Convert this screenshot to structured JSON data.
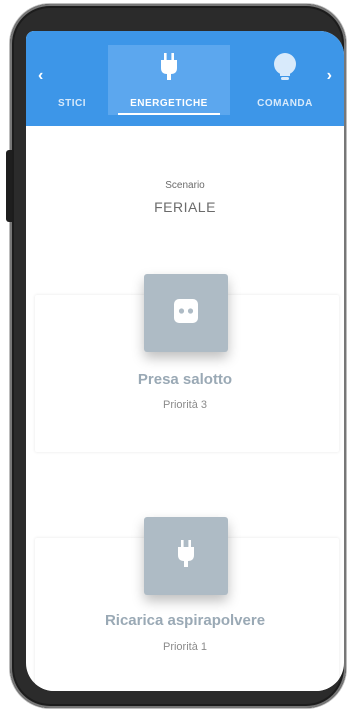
{
  "tabs": {
    "left_label": "STICI",
    "active_label": "ENERGETICHE",
    "right_label": "COMANDA"
  },
  "scenario": {
    "caption": "Scenario",
    "value": "FERIALE"
  },
  "devices": [
    {
      "name": "Presa salotto",
      "priority": "Priorità 3",
      "icon": "socket-icon"
    },
    {
      "name": "Ricarica aspirapolvere",
      "priority": "Priorità 1",
      "icon": "plug-icon"
    }
  ],
  "colors": {
    "tabbar": "#3d96e8",
    "active_tab": "#5ca7ee",
    "tile": "#aebbc5",
    "device_name": "#9aa9b5"
  }
}
